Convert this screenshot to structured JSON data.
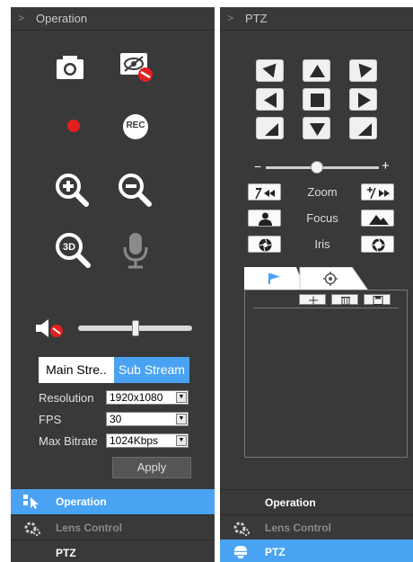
{
  "operation_panel": {
    "header": "Operation",
    "volume_level": 0.5,
    "streams": {
      "main": "Main Stre..",
      "sub": "Sub Stream",
      "selected": "sub"
    },
    "fields": [
      {
        "label": "Resolution",
        "value": "1920x1080"
      },
      {
        "label": "FPS",
        "value": "30"
      },
      {
        "label": "Max Bitrate",
        "value": "1024Kbps"
      }
    ],
    "apply": "Apply",
    "record_label": "REC",
    "nav": [
      {
        "label": "Operation",
        "active": true
      },
      {
        "label": "Lens Control",
        "active": false
      },
      {
        "label": "PTZ",
        "active": false
      }
    ]
  },
  "ptz_panel": {
    "header": "PTZ",
    "speed_level": 0.45,
    "speed_minus": "−",
    "speed_plus": "+",
    "zoom": "Zoom",
    "focus": "Focus",
    "iris": "Iris",
    "nav": [
      {
        "label": "Operation",
        "active": false
      },
      {
        "label": "Lens Control",
        "active": false
      },
      {
        "label": "PTZ",
        "active": true
      }
    ]
  },
  "colors": {
    "panel": "#393939",
    "accent": "#4aa3f2",
    "record": "#e02020",
    "disabled_text": "#8a8a8a"
  },
  "icons": {
    "operation": [
      "snapshot-icon",
      "privacy-mask-icon",
      "record-indicator-icon",
      "rec-icon",
      "zoom-in-icon",
      "zoom-out-icon",
      "3d-zoom-icon",
      "microphone-icon",
      "mute-icon"
    ],
    "ptz": [
      "flag-icon",
      "tour-icon",
      "add-icon",
      "delete-icon",
      "save-icon"
    ]
  }
}
